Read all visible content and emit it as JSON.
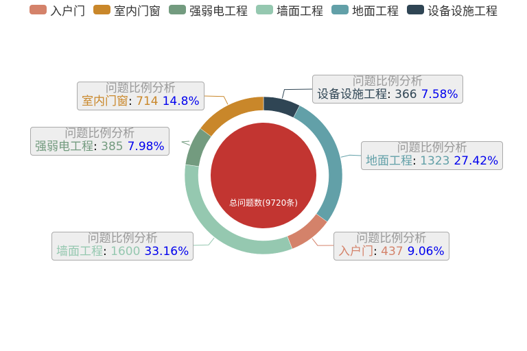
{
  "legend": [
    {
      "label": "入户门",
      "color": "#d4826a"
    },
    {
      "label": "室内门窗",
      "color": "#c9872a"
    },
    {
      "label": "强弱电工程",
      "color": "#739b7f"
    },
    {
      "label": "墙面工程",
      "color": "#95c8b0"
    },
    {
      "label": "地面工程",
      "color": "#62a0a8"
    },
    {
      "label": "设备设施工程",
      "color": "#2f4554"
    }
  ],
  "center_label": "总问题数(9720条)",
  "chart_data": {
    "type": "pie",
    "variant": "donut",
    "total": 9720,
    "center_color": "#c23531",
    "series_name": "问题比例分析",
    "slices": [
      {
        "name": "设备设施工程",
        "value": 366,
        "percent": "7.58%",
        "color": "#2f4554"
      },
      {
        "name": "地面工程",
        "value": 1323,
        "percent": "27.42%",
        "color": "#62a0a8"
      },
      {
        "name": "入户门",
        "value": 437,
        "percent": "9.06%",
        "color": "#d4826a"
      },
      {
        "name": "墙面工程",
        "value": 1600,
        "percent": "33.16%",
        "color": "#95c8b0"
      },
      {
        "name": "强弱电工程",
        "value": 385,
        "percent": "7.98%",
        "color": "#739b7f"
      },
      {
        "name": "室内门窗",
        "value": 714,
        "percent": "14.8%",
        "color": "#c9872a"
      }
    ]
  }
}
